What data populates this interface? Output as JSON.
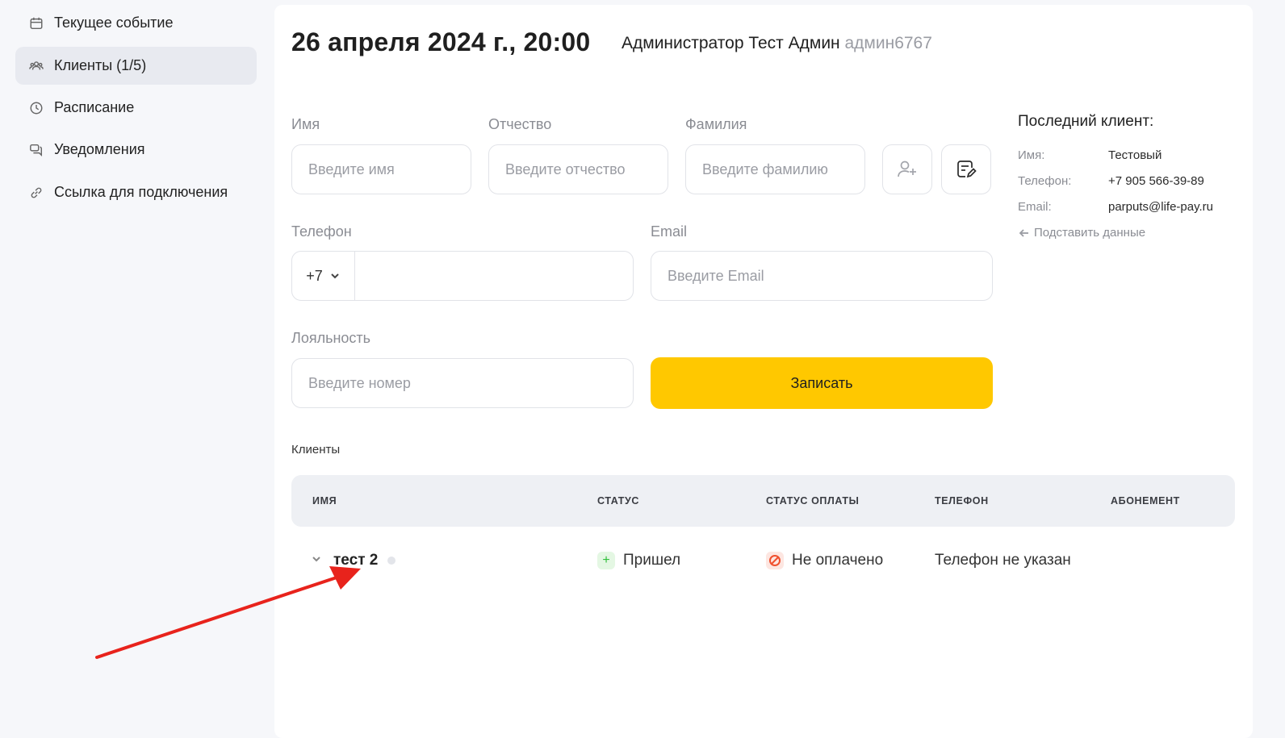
{
  "sidebar": {
    "items": [
      {
        "label": "Текущее событие",
        "icon": "calendar-icon"
      },
      {
        "label": "Клиенты (1/5)",
        "icon": "users-icon",
        "active": true
      },
      {
        "label": "Расписание",
        "icon": "clock-icon"
      },
      {
        "label": "Уведомления",
        "icon": "chat-icon"
      },
      {
        "label": "Ссылка для подключения",
        "icon": "link-icon"
      }
    ]
  },
  "header": {
    "datetime": "26 апреля 2024 г., 20:00",
    "admin_name": "Администратор Тест Админ",
    "admin_login": "админ6767"
  },
  "form": {
    "first_name": {
      "label": "Имя",
      "placeholder": "Введите имя",
      "value": ""
    },
    "patronymic": {
      "label": "Отчество",
      "placeholder": "Введите отчество",
      "value": ""
    },
    "last_name": {
      "label": "Фамилия",
      "placeholder": "Введите фамилию",
      "value": ""
    },
    "phone": {
      "label": "Телефон",
      "code": "+7",
      "value": ""
    },
    "email": {
      "label": "Email",
      "placeholder": "Введите Email",
      "value": ""
    },
    "loyalty": {
      "label": "Лояльность",
      "placeholder": "Введите номер",
      "value": ""
    },
    "submit_label": "Записать",
    "icons": {
      "add_user": "user-plus-icon",
      "notes": "note-edit-icon"
    }
  },
  "last_client": {
    "title": "Последний клиент:",
    "name_key": "Имя:",
    "name": "Тестовый",
    "phone_key": "Телефон:",
    "phone": "+7 905 566-39-89",
    "email_key": "Email:",
    "email": "parputs@life-pay.ru",
    "substitute_label": "Подставить данные"
  },
  "clients": {
    "section_title": "Клиенты",
    "columns": [
      "ИМЯ",
      "СТАТУС",
      "СТАТУС ОПЛАТЫ",
      "ТЕЛЕФОН",
      "АБОНЕМЕНТ"
    ],
    "rows": [
      {
        "name": "тест 2",
        "status": "Пришел",
        "payment_status": "Не оплачено",
        "phone": "Телефон не указан",
        "subscription": ""
      }
    ]
  },
  "colors": {
    "accent": "#ffc800",
    "annotation_arrow": "#e8231c",
    "status_ok": "#2fbf3a",
    "status_unpaid": "#f0502e"
  }
}
